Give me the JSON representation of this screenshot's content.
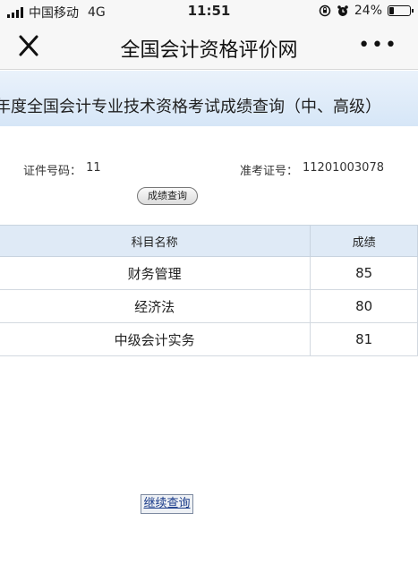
{
  "status_bar": {
    "carrier": "中国移动",
    "network": "4G",
    "time": "11:51",
    "battery": "24%",
    "battery_level": 0.24
  },
  "nav": {
    "title": "全国会计资格评价网",
    "more": "•••"
  },
  "page": {
    "title": "年度全国会计专业技术资格考试成绩查询（中、高级）",
    "id_label": "证件号码：",
    "id_value": "‌‌                            11",
    "ticket_label": "准考证号：",
    "ticket_value": "11201003078",
    "query_button": "成绩查询"
  },
  "table": {
    "headers": [
      "科目名称",
      "成绩"
    ],
    "rows": [
      {
        "subject": "财务管理",
        "score": "85"
      },
      {
        "subject": "经济法",
        "score": "80"
      },
      {
        "subject": "中级会计实务",
        "score": "81"
      }
    ]
  },
  "continue_button": "继续查询"
}
